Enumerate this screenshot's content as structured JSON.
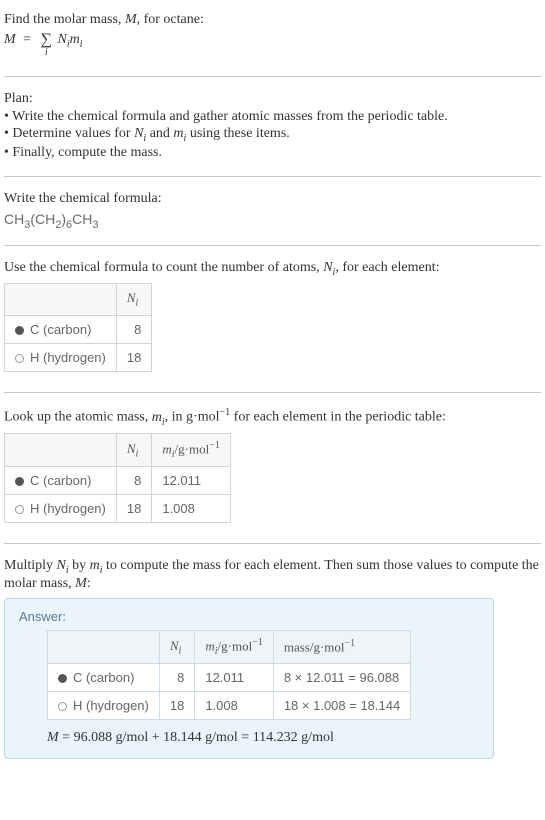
{
  "intro": {
    "line1_pre": "Find the molar mass, ",
    "line1_var": "M",
    "line1_post": ", for octane:",
    "eq_lhs": "M",
    "eq_sum_sub": "i",
    "eq_rhs_N": "N",
    "eq_rhs_m": "m"
  },
  "plan": {
    "title": "Plan:",
    "items": [
      "• Write the chemical formula and gather atomic masses from the periodic table.",
      "• Determine values for Nᵢ and mᵢ using these items.",
      "• Finally, compute the mass."
    ]
  },
  "chemformula": {
    "title": "Write the chemical formula:",
    "parts": [
      "CH",
      "3",
      "(CH",
      "2",
      ")",
      "6",
      "CH",
      "3"
    ]
  },
  "count_atoms": {
    "title_pre": "Use the chemical formula to count the number of atoms, ",
    "title_var": "N",
    "title_sub": "i",
    "title_post": ", for each element:",
    "hdr_N": "N",
    "hdr_N_sub": "i",
    "rows": [
      {
        "dot": "filled",
        "label": "C (carbon)",
        "N": "8"
      },
      {
        "dot": "hollow",
        "label": "H (hydrogen)",
        "N": "18"
      }
    ]
  },
  "atomic_mass": {
    "title_pre": "Look up the atomic mass, ",
    "title_var": "m",
    "title_sub": "i",
    "title_mid": ", in g·mol",
    "title_sup": "−1",
    "title_post": " for each element in the periodic table:",
    "hdr_N": "N",
    "hdr_N_sub": "i",
    "hdr_m": "m",
    "hdr_m_sub": "i",
    "hdr_unit": "/g·mol",
    "hdr_unit_sup": "−1",
    "rows": [
      {
        "dot": "filled",
        "label": "C (carbon)",
        "N": "8",
        "m": "12.011"
      },
      {
        "dot": "hollow",
        "label": "H (hydrogen)",
        "N": "18",
        "m": "1.008"
      }
    ]
  },
  "compute": {
    "title": "Multiply Nᵢ by mᵢ to compute the mass for each element. Then sum those values to compute the molar mass, M:"
  },
  "answer": {
    "label": "Answer:",
    "hdr_N": "N",
    "hdr_N_sub": "i",
    "hdr_m": "m",
    "hdr_m_sub": "i",
    "hdr_m_unit": "/g·mol",
    "hdr_m_sup": "−1",
    "hdr_mass": "mass/g·mol",
    "hdr_mass_sup": "−1",
    "rows": [
      {
        "dot": "filled",
        "label": "C (carbon)",
        "N": "8",
        "m": "12.011",
        "mass": "8 × 12.011 = 96.088"
      },
      {
        "dot": "hollow",
        "label": "H (hydrogen)",
        "N": "18",
        "m": "1.008",
        "mass": "18 × 1.008 = 18.144"
      }
    ],
    "result_lhs": "M",
    "result_rhs": " = 96.088 g/mol + 18.144 g/mol = 114.232 g/mol"
  }
}
